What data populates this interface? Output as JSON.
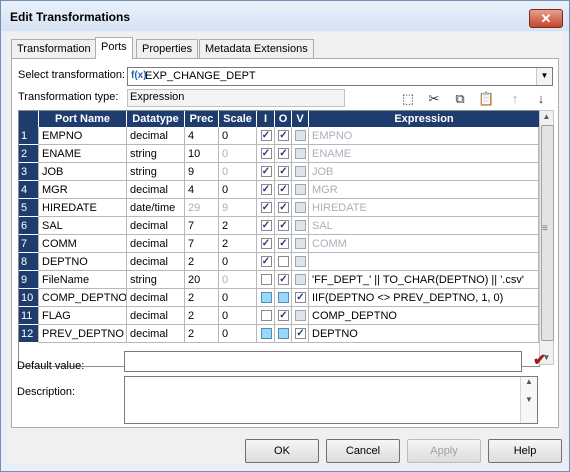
{
  "window": {
    "title": "Edit Transformations",
    "close_label": "✕"
  },
  "tabs": [
    {
      "label": "Transformation"
    },
    {
      "label": "Ports"
    },
    {
      "label": "Properties"
    },
    {
      "label": "Metadata Extensions"
    }
  ],
  "active_tab": "Ports",
  "select_transformation": {
    "label": "Select transformation:",
    "icon": "f(x)",
    "value": "EXP_CHANGE_DEPT"
  },
  "transformation_type": {
    "label": "Transformation type:",
    "value": "Expression"
  },
  "toolbar": {
    "icons": [
      "new-port-icon",
      "cut-icon",
      "copy-icon",
      "paste-icon",
      "move-up-icon",
      "move-down-icon"
    ]
  },
  "grid": {
    "headers": {
      "port_name": "Port Name",
      "datatype": "Datatype",
      "prec": "Prec",
      "scale": "Scale",
      "i": "I",
      "o": "O",
      "v": "V",
      "expression": "Expression"
    },
    "rows": [
      {
        "n": "1",
        "name": "EMPNO",
        "type": "decimal",
        "prec": "4",
        "scale": "0",
        "prec_gray": false,
        "scale_gray": false,
        "i": "checked",
        "o": "checked",
        "v": "empty",
        "expr": "EMPNO",
        "expr_gray": true
      },
      {
        "n": "2",
        "name": "ENAME",
        "type": "string",
        "prec": "10",
        "scale": "0",
        "prec_gray": false,
        "scale_gray": true,
        "i": "checked",
        "o": "checked",
        "v": "empty",
        "expr": "ENAME",
        "expr_gray": true
      },
      {
        "n": "3",
        "name": "JOB",
        "type": "string",
        "prec": "9",
        "scale": "0",
        "prec_gray": false,
        "scale_gray": true,
        "i": "checked",
        "o": "checked",
        "v": "empty",
        "expr": "JOB",
        "expr_gray": true
      },
      {
        "n": "4",
        "name": "MGR",
        "type": "decimal",
        "prec": "4",
        "scale": "0",
        "prec_gray": false,
        "scale_gray": false,
        "i": "checked",
        "o": "checked",
        "v": "empty",
        "expr": "MGR",
        "expr_gray": true
      },
      {
        "n": "5",
        "name": "HIREDATE",
        "type": "date/time",
        "prec": "29",
        "scale": "9",
        "prec_gray": true,
        "scale_gray": true,
        "i": "checked",
        "o": "checked",
        "v": "empty",
        "expr": "HIREDATE",
        "expr_gray": true
      },
      {
        "n": "6",
        "name": "SAL",
        "type": "decimal",
        "prec": "7",
        "scale": "2",
        "prec_gray": false,
        "scale_gray": false,
        "i": "checked",
        "o": "checked",
        "v": "empty",
        "expr": "SAL",
        "expr_gray": true
      },
      {
        "n": "7",
        "name": "COMM",
        "type": "decimal",
        "prec": "7",
        "scale": "2",
        "prec_gray": false,
        "scale_gray": false,
        "i": "checked",
        "o": "checked",
        "v": "empty",
        "expr": "COMM",
        "expr_gray": true
      },
      {
        "n": "8",
        "name": "DEPTNO",
        "type": "decimal",
        "prec": "2",
        "scale": "0",
        "prec_gray": false,
        "scale_gray": false,
        "i": "checked",
        "o": "empty",
        "v": "empty",
        "expr": "",
        "expr_gray": false
      },
      {
        "n": "9",
        "name": "FileName",
        "type": "string",
        "prec": "20",
        "scale": "0",
        "prec_gray": false,
        "scale_gray": true,
        "i": "empty",
        "o": "checked",
        "v": "empty",
        "expr": "'FF_DEPT_' || TO_CHAR(DEPTNO) || '.csv'",
        "expr_gray": false
      },
      {
        "n": "10",
        "name": "COMP_DEPTNO",
        "type": "decimal",
        "prec": "2",
        "scale": "0",
        "prec_gray": false,
        "scale_gray": false,
        "i": "blue",
        "o": "blue",
        "v": "checked",
        "expr": "IIF(DEPTNO <> PREV_DEPTNO, 1, 0)",
        "expr_gray": false
      },
      {
        "n": "11",
        "name": "FLAG",
        "type": "decimal",
        "prec": "2",
        "scale": "0",
        "prec_gray": false,
        "scale_gray": false,
        "i": "empty",
        "o": "checked",
        "v": "empty",
        "expr": "COMP_DEPTNO",
        "expr_gray": false
      },
      {
        "n": "12",
        "name": "PREV_DEPTNO",
        "type": "decimal",
        "prec": "2",
        "scale": "0",
        "prec_gray": false,
        "scale_gray": false,
        "i": "blue",
        "o": "blue",
        "v": "checked",
        "expr": "DEPTNO",
        "expr_gray": false
      }
    ]
  },
  "default_value": {
    "label": "Default value:",
    "value": "",
    "validate_icon": "checkmark-icon",
    "validate_glyph": "✔"
  },
  "description": {
    "label": "Description:",
    "value": ""
  },
  "buttons": {
    "ok": "OK",
    "cancel": "Cancel",
    "apply": "Apply",
    "help": "Help"
  },
  "colors": {
    "grid_header": "#1e3c6e",
    "validate": "#a01818"
  }
}
